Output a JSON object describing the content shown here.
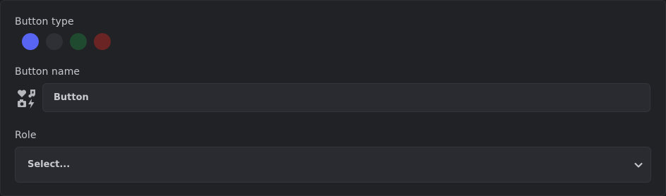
{
  "button_type": {
    "label": "Button type",
    "options": [
      {
        "name": "primary",
        "color": "#5865f2",
        "selected": true
      },
      {
        "name": "secondary",
        "color": "#2e3035",
        "selected": false
      },
      {
        "name": "success",
        "color": "#1f4a30",
        "selected": false
      },
      {
        "name": "danger",
        "color": "#6a2424",
        "selected": false
      }
    ]
  },
  "button_name": {
    "label": "Button name",
    "value": "Button",
    "emoji_picker_icon": "emoji-picker-icon"
  },
  "role": {
    "label": "Role",
    "selected_text": "Select...",
    "dropdown_icon": "chevron-down-icon"
  }
}
